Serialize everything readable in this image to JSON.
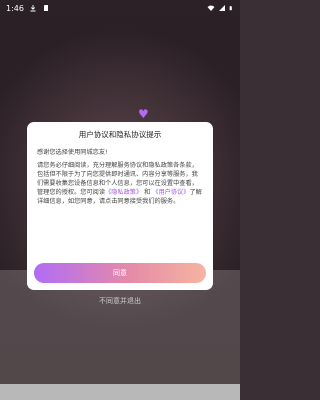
{
  "status_bar": {
    "time": "1:46"
  },
  "dialog": {
    "title": "用户协议和隐私协议提示",
    "thanks": "感谢您选择使用同城恋友!",
    "body_part1": "请您务必仔细阅读，充分理解服务协议和隐私政策各条款，包括但不限于为了向您提供即时通讯、内容分享等服务，我们需要收集您设备信息和个人信息，您可以在设置中查看，管理您的授权。您可阅读",
    "privacy_link": "《隐私政策》",
    "and": "和",
    "user_link": "《用户协议》",
    "body_part2": "了解详细信息，如您同意，请点击同意接受我们的服务。",
    "agree_label": "同意"
  },
  "disagree_label": "不同意并退出"
}
